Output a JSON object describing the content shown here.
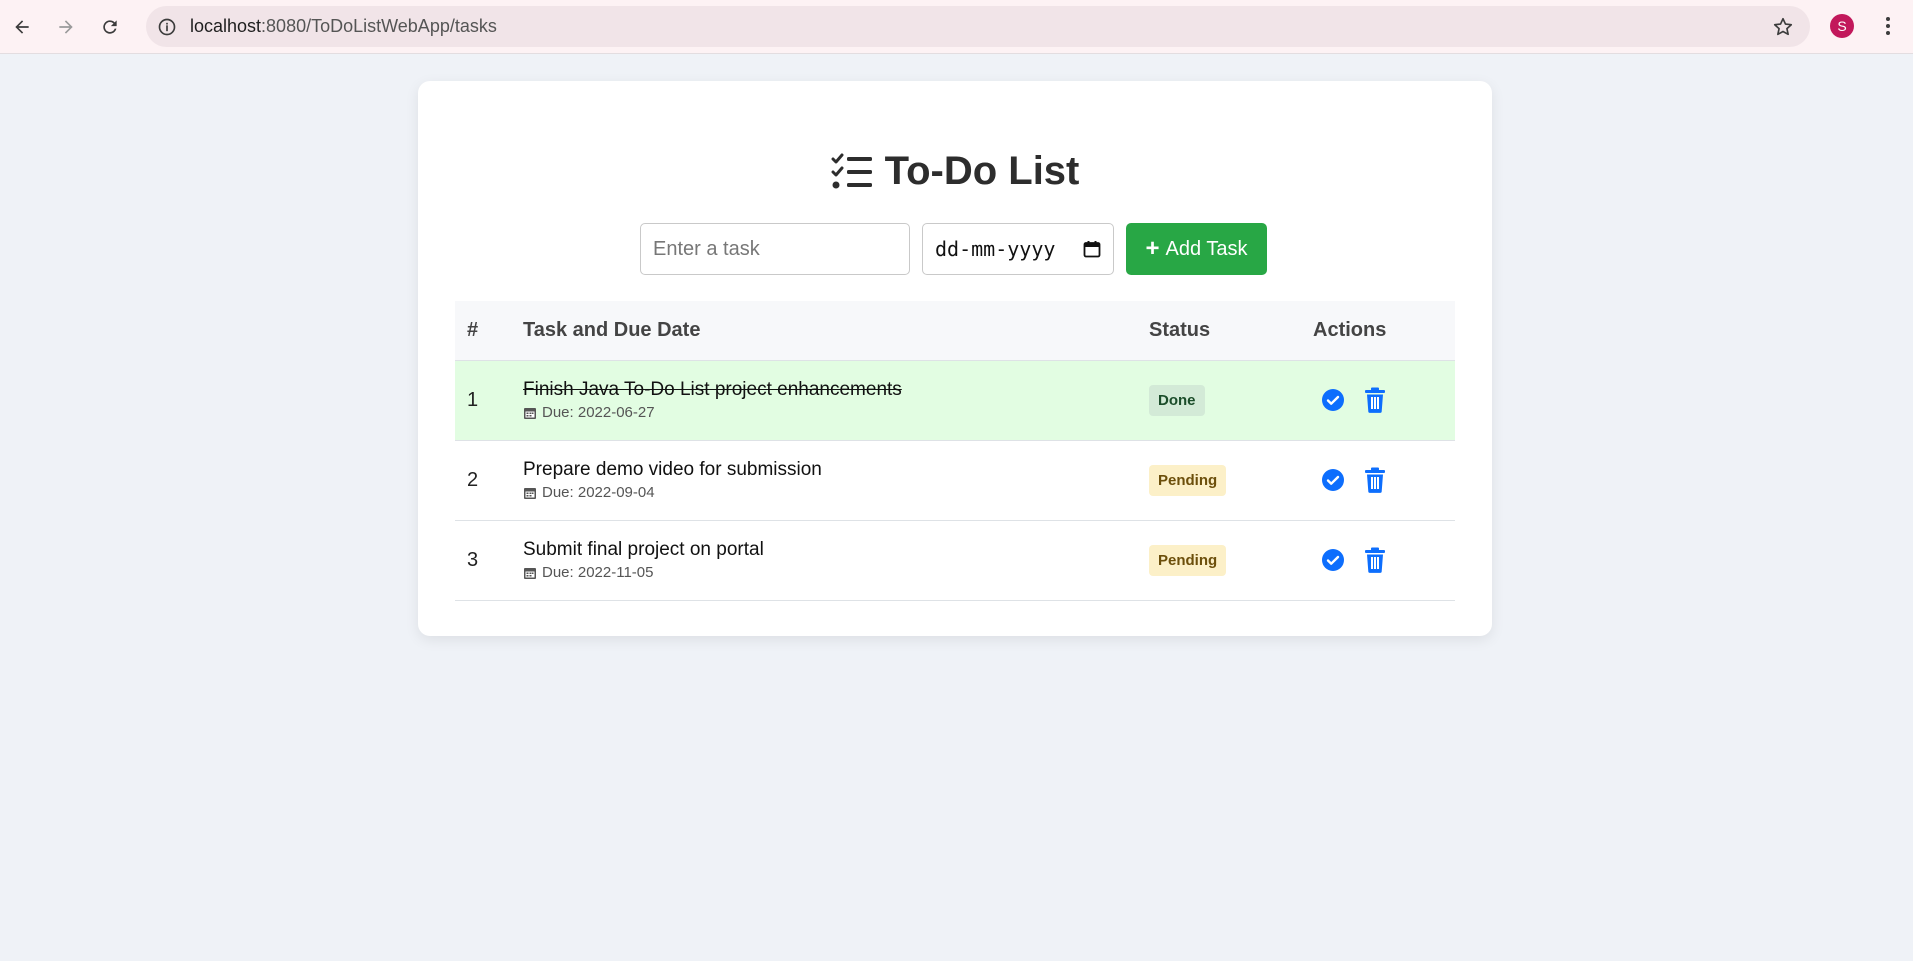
{
  "browser": {
    "url_host": "localhost",
    "url_rest": ":8080/ToDoListWebApp/tasks",
    "avatar_letter": "S"
  },
  "app": {
    "title": "To-Do List",
    "form": {
      "task_placeholder": "Enter a task",
      "date_placeholder": "dd-mm-yyyy",
      "add_label": "Add Task"
    },
    "table": {
      "headers": [
        "#",
        "Task and Due Date",
        "Status",
        "Actions"
      ],
      "rows": [
        {
          "num": "1",
          "task": "Finish Java To-Do List project enhancements",
          "due": "Due: 2022-06-27",
          "status": "Done",
          "done": true
        },
        {
          "num": "2",
          "task": "Prepare demo video for submission",
          "due": "Due: 2022-09-04",
          "status": "Pending",
          "done": false
        },
        {
          "num": "3",
          "task": "Submit final project on portal",
          "due": "Due: 2022-11-05",
          "status": "Pending",
          "done": false
        }
      ]
    }
  },
  "colors": {
    "accent_green": "#28a745",
    "action_blue": "#0d6efd",
    "done_row": "#e2fde2"
  }
}
